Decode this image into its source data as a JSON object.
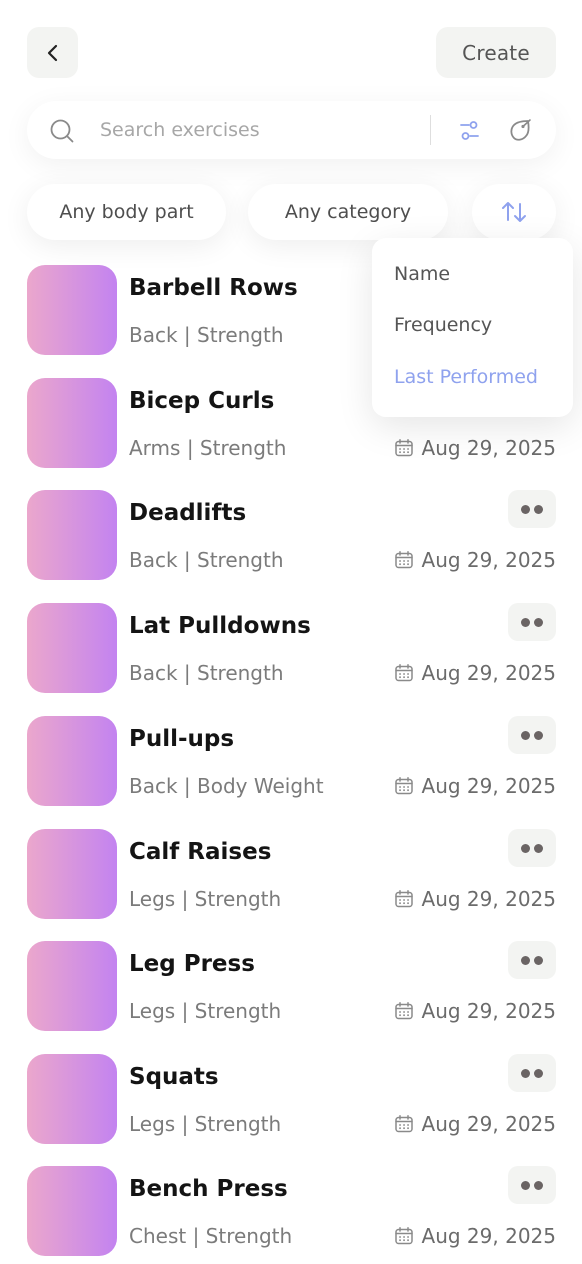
{
  "header": {
    "create_label": "Create"
  },
  "search": {
    "placeholder": "Search exercises"
  },
  "filters": {
    "body_part": "Any body part",
    "category": "Any category"
  },
  "sort_menu": {
    "options": [
      "Name",
      "Frequency",
      "Last Performed"
    ],
    "selected": "Last Performed"
  },
  "exercises": [
    {
      "name": "Barbell Rows",
      "meta": "Back | Strength",
      "date": ""
    },
    {
      "name": "Bicep Curls",
      "meta": "Arms | Strength",
      "date": "Aug 29, 2025"
    },
    {
      "name": "Deadlifts",
      "meta": "Back | Strength",
      "date": "Aug 29, 2025"
    },
    {
      "name": "Lat Pulldowns",
      "meta": "Back | Strength",
      "date": "Aug 29, 2025"
    },
    {
      "name": "Pull-ups",
      "meta": "Back | Body Weight",
      "date": "Aug 29, 2025"
    },
    {
      "name": "Calf Raises",
      "meta": "Legs | Strength",
      "date": "Aug 29, 2025"
    },
    {
      "name": "Leg Press",
      "meta": "Legs | Strength",
      "date": "Aug 29, 2025"
    },
    {
      "name": "Squats",
      "meta": "Legs | Strength",
      "date": "Aug 29, 2025"
    },
    {
      "name": "Bench Press",
      "meta": "Chest | Strength",
      "date": "Aug 29, 2025"
    }
  ],
  "colors": {
    "accent": "#8fa2ee",
    "thumb_gradient_start": "#eba7cc",
    "thumb_gradient_end": "#c383f0",
    "button_bg": "#f3f4f2"
  }
}
